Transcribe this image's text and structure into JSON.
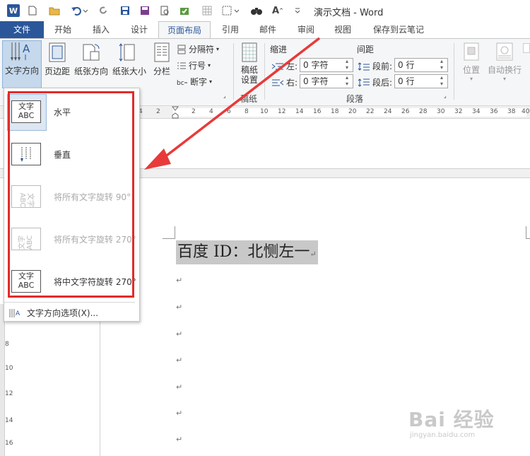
{
  "window": {
    "title": "演示文档 - Word"
  },
  "app_logo": "W",
  "tabs": [
    {
      "label": "文件",
      "id": "file"
    },
    {
      "label": "开始",
      "id": "home"
    },
    {
      "label": "插入",
      "id": "insert"
    },
    {
      "label": "设计",
      "id": "design"
    },
    {
      "label": "页面布局",
      "id": "layout",
      "active": true
    },
    {
      "label": "引用",
      "id": "references"
    },
    {
      "label": "邮件",
      "id": "mailings"
    },
    {
      "label": "审阅",
      "id": "review"
    },
    {
      "label": "视图",
      "id": "view"
    },
    {
      "label": "保存到云笔记",
      "id": "cloudnote"
    }
  ],
  "ribbon": {
    "text_direction": "文字方向",
    "margins": "页边距",
    "orientation": "纸张方向",
    "size": "纸张大小",
    "columns": "分栏",
    "breaks": "分隔符",
    "line_numbers": "行号",
    "hyphenation": "断字",
    "manuscript_line1": "稿纸",
    "manuscript_line2": "设置",
    "manuscript_group": "稿纸",
    "indent_title": "缩进",
    "spacing_title": "间距",
    "indent_left_label": "左:",
    "indent_left_value": "0 字符",
    "indent_right_label": "右:",
    "indent_right_value": "0 字符",
    "space_before_label": "段前:",
    "space_before_value": "0 行",
    "space_after_label": "段后:",
    "space_after_value": "0 行",
    "paragraph_group": "段落",
    "position": "位置",
    "wrap_text": "自动换行"
  },
  "ruler_numbers": [
    "4",
    "2",
    "2",
    "4",
    "6",
    "8",
    "10",
    "12",
    "14",
    "16",
    "18",
    "20",
    "22",
    "24",
    "26",
    "28",
    "30",
    "32",
    "34",
    "36",
    "38",
    "40"
  ],
  "vruler_numbers": [
    "8",
    "10",
    "12",
    "14",
    "16"
  ],
  "menu": {
    "items": [
      {
        "label": "水平",
        "thumb_top": "文字",
        "thumb_bottom": "ABC",
        "disabled": false
      },
      {
        "label": "垂直",
        "thumb_top": "",
        "thumb_bottom": "",
        "disabled": false
      },
      {
        "label": "将所有文字旋转 90°",
        "thumb_top": "文字",
        "thumb_bottom": "ABC",
        "disabled": true
      },
      {
        "label": "将所有文字旋转 270°",
        "thumb_top": "文字",
        "thumb_bottom": "ABC",
        "disabled": true
      },
      {
        "label": "将中文字符旋转 270°",
        "thumb_top": "文字",
        "thumb_bottom": "ABC",
        "disabled": false
      }
    ],
    "options": "文字方向选项(X)..."
  },
  "document": {
    "text": "百度 ID：北恻左一",
    "paragraph_mark": "↵"
  },
  "watermark": {
    "logo": "Bai 经验",
    "url": "jingyan.baidu.com"
  },
  "colors": {
    "word_blue": "#2b579a",
    "highlight_red": "#e12b2b"
  }
}
